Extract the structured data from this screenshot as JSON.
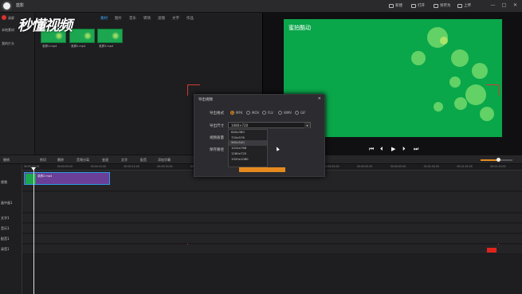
{
  "titlebar": {
    "title": "蓝影",
    "buttons": [
      "新建",
      "打开",
      "另存为",
      "上传"
    ],
    "window_controls": [
      "—",
      "□",
      "✕"
    ]
  },
  "watermark": "秒懂视频",
  "sidebar": {
    "items": [
      "录屏",
      "本地素材",
      "我的片头"
    ]
  },
  "media_tabs": {
    "tabs": [
      "素材",
      "图片",
      "音乐",
      "转场",
      "滤镜",
      "文字",
      "作品"
    ],
    "active_index": 0
  },
  "media": {
    "thumbs": [
      {
        "label": "录屏1.mp4"
      },
      {
        "label": "录屏2.mp4"
      },
      {
        "label": "录屏3.mp4"
      }
    ]
  },
  "preview": {
    "video_title": "蜜拍酷动",
    "controls": [
      "⏮",
      "⏴",
      "▶",
      "⏵",
      "⏭"
    ]
  },
  "timeline_toolbar": {
    "tools": [
      "撤销",
      "剪切",
      "删除",
      "音频分离",
      "变速",
      "文字",
      "配音",
      "添加字幕"
    ]
  },
  "ruler": {
    "ticks": [
      "00:00:00.00",
      "00:00:05.00",
      "00:00:10.00",
      "00:00:15.00",
      "00:00:20.00",
      "00:00:25.00",
      "00:00:30.00",
      "00:00:35.00",
      "00:00:40.00",
      "00:00:45.00",
      "00:00:50.00",
      "00:00:55.00",
      "00:01:00.00",
      "00:01:05.00",
      "00:01:10.00"
    ]
  },
  "tracks": [
    {
      "label": "视频"
    },
    {
      "label": "画中画1"
    },
    {
      "label": "文字1"
    },
    {
      "label": "音乐1"
    },
    {
      "label": "配音1"
    },
    {
      "label": "录音1"
    }
  ],
  "clip": {
    "label": "录屏2.mp4"
  },
  "modal": {
    "title": "导出视频",
    "close": "✕",
    "format_label": "导出格式",
    "formats": [
      "MP4",
      "MOV",
      "FLV",
      "WMV",
      "GIF"
    ],
    "selected_format": "MP4",
    "size_label": "导出尺寸",
    "quality_label": "视频质量",
    "path_label": "保存路径",
    "size_value": "1080×720",
    "size_arrow": "▾",
    "size_options": [
      "640x360",
      "720x576",
      "960x540",
      "1024x768",
      "1280x720",
      "1920x1080"
    ],
    "hover_option_index": 2
  },
  "colors": {
    "accent": "#e58a1f",
    "record": "#e0312b",
    "clip": "#6a3f98",
    "video_bg": "#0aa64a"
  }
}
